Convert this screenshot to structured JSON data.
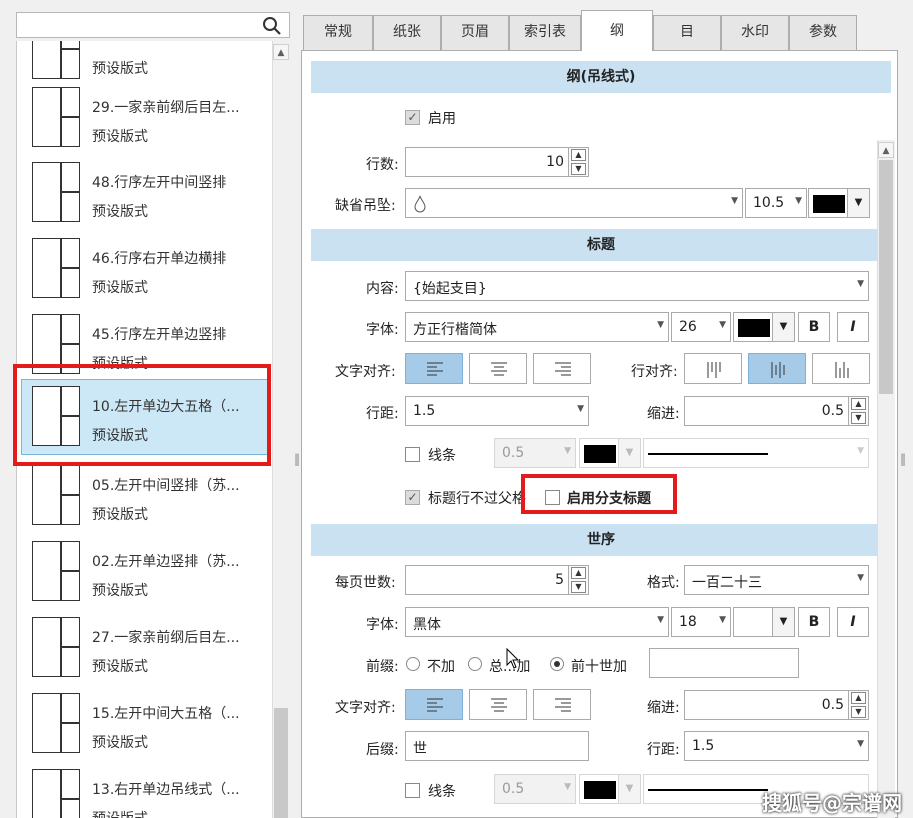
{
  "search": {
    "placeholder": ""
  },
  "template_list": [
    {
      "title": "",
      "subtitle": "预设版式"
    },
    {
      "title": "29.一家亲前纲后目左...",
      "subtitle": "预设版式"
    },
    {
      "title": "48.行序左开中间竖排",
      "subtitle": "预设版式"
    },
    {
      "title": "46.行序右开单边横排",
      "subtitle": "预设版式"
    },
    {
      "title": "45.行序左开单边竖排",
      "subtitle": "预设版式"
    },
    {
      "title": "10.左开单边大五格（...",
      "subtitle": "预设版式",
      "selected": true
    },
    {
      "title": "05.左开中间竖排（苏...",
      "subtitle": "预设版式"
    },
    {
      "title": "02.左开单边竖排（苏...",
      "subtitle": "预设版式"
    },
    {
      "title": "27.一家亲前纲后目左...",
      "subtitle": "预设版式"
    },
    {
      "title": "15.左开中间大五格（...",
      "subtitle": "预设版式"
    },
    {
      "title": "13.右开单边吊线式（...",
      "subtitle": "预设版式"
    }
  ],
  "tabs": [
    {
      "label": "常规"
    },
    {
      "label": "纸张"
    },
    {
      "label": "页眉"
    },
    {
      "label": "索引表"
    },
    {
      "label": "纲",
      "active": true
    },
    {
      "label": "目"
    },
    {
      "label": "水印"
    },
    {
      "label": "参数"
    }
  ],
  "gang_section": {
    "header": "纲(吊线式)",
    "enable_label": "启用",
    "enable_checked": true,
    "rows_label": "行数:",
    "rows_value": "10",
    "pendant_label": "缺省吊坠:",
    "pendant_size": "10.5",
    "pendant_color": "#000000"
  },
  "title_section": {
    "header": "标题",
    "content_label": "内容:",
    "content_value": "{始起支目}",
    "font_label": "字体:",
    "font_value": "方正行楷简体",
    "font_size": "26",
    "font_color": "#000000",
    "bold_label": "B",
    "italic_label": "I",
    "text_align_label": "文字对齐:",
    "text_align_selected": "left",
    "row_align_label": "行对齐:",
    "row_align_selected": "center",
    "line_spacing_label": "行距:",
    "line_spacing_value": "1.5",
    "indent_label": "缩进:",
    "indent_value": "0.5",
    "line_label": "线条",
    "line_checked": false,
    "line_width": "0.5",
    "line_color": "#000000",
    "no_cross_parent_label": "标题行不过父格",
    "no_cross_parent_checked": true,
    "branch_title_label": "启用分支标题",
    "branch_title_checked": false
  },
  "generation_section": {
    "header": "世序",
    "per_page_label": "每页世数:",
    "per_page_value": "5",
    "format_label": "格式:",
    "format_value": "一百二十三",
    "font_label": "字体:",
    "font_value": "黑体",
    "font_size": "18",
    "bold_label": "B",
    "italic_label": "I",
    "prefix_label": "前缀:",
    "prefix_options": [
      "不加",
      "总...加",
      "前十世加"
    ],
    "prefix_selected": 2,
    "prefix_text": "",
    "text_align_label": "文字对齐:",
    "text_align_selected": "left",
    "indent_label": "缩进:",
    "indent_value": "0.5",
    "suffix_label": "后缀:",
    "suffix_value": "世",
    "line_spacing_label": "行距:",
    "line_spacing_value": "1.5",
    "line_label": "线条",
    "line_checked": false,
    "line_width": "0.5",
    "line_color": "#000000"
  },
  "watermark": "搜狐号@宗谱网",
  "colors": {
    "accent": "#c9e1f1",
    "selection": "#cce8f6",
    "highlight_box": "#e41b1b"
  }
}
